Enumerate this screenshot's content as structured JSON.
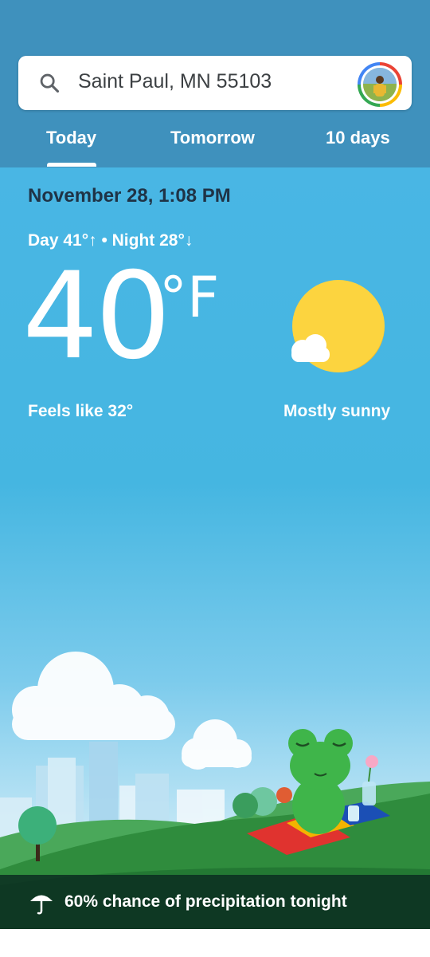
{
  "search": {
    "location": "Saint Paul, MN 55103",
    "icon": "search-icon"
  },
  "tabs": [
    {
      "label": "Today",
      "selected": true
    },
    {
      "label": "Tomorrow",
      "selected": false
    },
    {
      "label": "10 days",
      "selected": false
    }
  ],
  "current": {
    "datetime": "November 28, 1:08 PM",
    "hilo": "Day 41°↑ • Night 28°↓",
    "temperature": "40",
    "unit": "°F",
    "feels_like": "Feels like 32°",
    "condition": "Mostly sunny",
    "condition_icon": "sun-cloud-icon"
  },
  "precipitation": {
    "text": "60% chance of precipitation tonight",
    "icon": "umbrella-icon"
  },
  "colors": {
    "header": "#3f91bd",
    "sky": "#45b6e1",
    "sun": "#fcd43f",
    "grass": "#2e8b3d",
    "frog": "#3fb54a"
  }
}
